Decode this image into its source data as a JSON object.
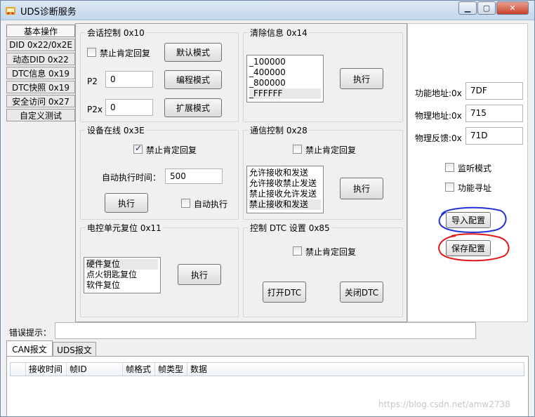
{
  "window": {
    "title": "UDS诊断服务",
    "controls": [
      "minimize-icon",
      "maximize-icon",
      "close-icon"
    ]
  },
  "left_tabs": [
    {
      "label": "基本操作",
      "active": true
    },
    {
      "label": "DID 0x22/0x2E"
    },
    {
      "label": "动态DID 0x22"
    },
    {
      "label": "DTC信息 0x19"
    },
    {
      "label": "DTC快照 0x19"
    },
    {
      "label": "安全访问 0x27"
    },
    {
      "label": "自定义测试"
    }
  ],
  "session_control": {
    "title": "会话控制 0x10",
    "suppress_label": "禁止肯定回复",
    "suppress_checked": false,
    "p2_label": "P2",
    "p2_value": "0",
    "p2x_label": "P2x",
    "p2x_value": "0",
    "default_btn": "默认模式",
    "program_btn": "编程模式",
    "extended_btn": "扩展模式"
  },
  "clear_info": {
    "title": "清除信息 0x14",
    "items": [
      "_100000",
      "_400000",
      "_800000",
      "_FFFFFF"
    ],
    "selected_index": 3,
    "execute_btn": "执行"
  },
  "tester_present": {
    "title": "设备在线 0x3E",
    "suppress_label": "禁止肯定回复",
    "suppress_checked": true,
    "auto_time_label": "自动执行时间：",
    "auto_time_value": "500",
    "execute_btn": "执行",
    "auto_exec_label": "自动执行",
    "auto_exec_checked": false
  },
  "comm_control": {
    "title": "通信控制 0x28",
    "suppress_label": "禁止肯定回复",
    "suppress_checked": false,
    "items": [
      "允许接收和发送",
      "允许接收禁止发送",
      "禁止接收允许发送",
      "禁止接收和发送"
    ],
    "selected_index": 3,
    "execute_btn": "执行"
  },
  "ecu_reset": {
    "title": "电控单元复位 0x11",
    "items": [
      "硬件复位",
      "点火钥匙复位",
      "软件复位"
    ],
    "selected_index": 0,
    "execute_btn": "执行"
  },
  "dtc_setting": {
    "title": "控制 DTC 设置  0x85",
    "suppress_label": "禁止肯定回复",
    "suppress_checked": false,
    "open_btn": "打开DTC",
    "close_btn": "关闭DTC"
  },
  "config": {
    "func_addr_label": "功能地址:0x",
    "func_addr_value": "7DF",
    "phys_addr_label": "物理地址:0x",
    "phys_addr_value": "715",
    "phys_resp_label": "物理反馈:0x",
    "phys_resp_value": "71D",
    "monitor_label": "监听模式",
    "monitor_checked": false,
    "func_address_label": "功能寻址",
    "func_address_checked": false,
    "import_btn": "导入配置",
    "save_btn": "保存配置"
  },
  "error": {
    "label": "错误提示：",
    "value": ""
  },
  "bottom_tabs": [
    {
      "label": "CAN报文",
      "active": true
    },
    {
      "label": "UDS报文"
    }
  ],
  "grid_columns": [
    "接收时间",
    "帧ID",
    "帧格式",
    "帧类型",
    "数据"
  ],
  "watermark": "https://blog.csdn.net/amw2738",
  "colors": {
    "annotation_blue": "#1f33d6",
    "annotation_red": "#e0181a"
  }
}
